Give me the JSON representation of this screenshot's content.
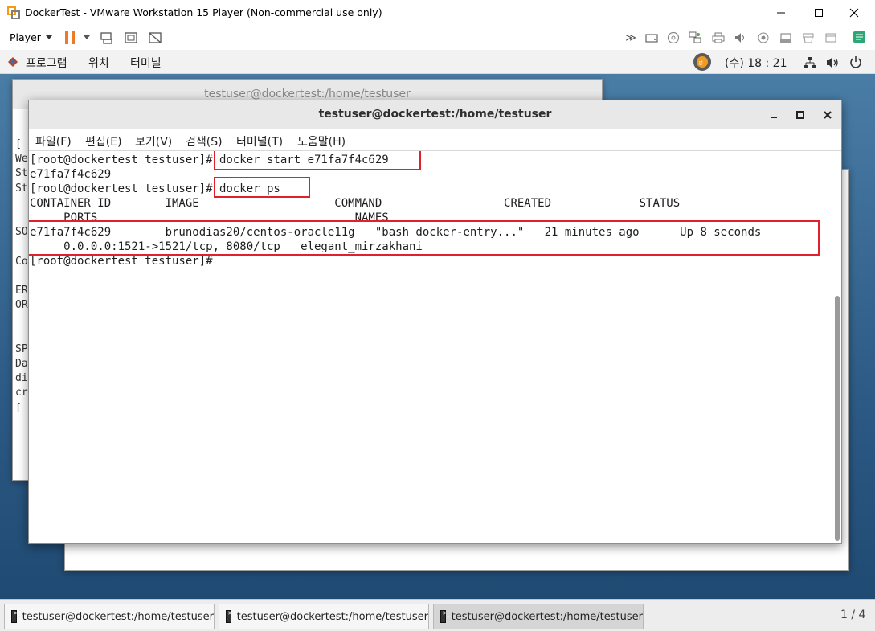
{
  "vm_window": {
    "title": "DockerTest - VMware Workstation 15 Player (Non-commercial use only)",
    "player_menu": "Player"
  },
  "gnome_bar": {
    "menus": [
      "프로그램",
      "위치",
      "터미널"
    ],
    "clock": "(수) 18 : 21"
  },
  "bg_terminal": {
    "title": "testuser@dockertest:/home/testuser",
    "partial_lines": [
      "[ r",
      "We",
      "St",
      "St",
      "",
      "",
      "SO",
      "",
      "Co",
      "",
      "ER",
      "OR",
      "",
      "",
      "SP",
      "Da",
      "di",
      "cr",
      "[ r"
    ]
  },
  "terminal": {
    "title": "testuser@dockertest:/home/testuser",
    "menus": [
      "파일(F)",
      "편집(E)",
      "보기(V)",
      "검색(S)",
      "터미널(T)",
      "도움말(H)"
    ],
    "lines": [
      "[root@dockertest testuser]# docker start e71fa7f4c629",
      "e71fa7f4c629",
      "[root@dockertest testuser]# docker ps",
      "CONTAINER ID        IMAGE                    COMMAND                  CREATED             STATUS",
      "     PORTS                                      NAMES",
      "e71fa7f4c629        brunodias20/centos-oracle11g   \"bash docker-entry...\"   21 minutes ago      Up 8 seconds",
      "     0.0.0.0:1521->1521/tcp, 8080/tcp   elegant_mirzakhani",
      "[root@dockertest testuser]#"
    ]
  },
  "taskbar": {
    "tasks": [
      "testuser@dockertest:/home/testuser",
      "testuser@dockertest:/home/testuser",
      "testuser@dockertest:/home/testuser"
    ],
    "workspace": "1 / 4"
  }
}
